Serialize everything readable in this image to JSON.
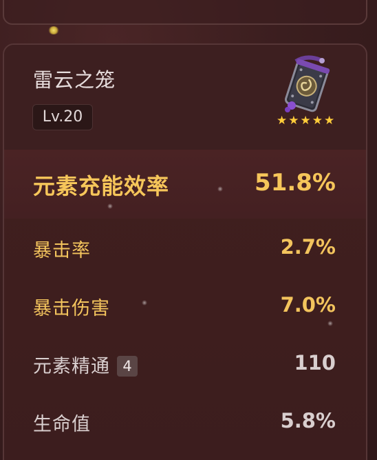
{
  "artifact": {
    "name": "雷云之笼",
    "level": "Lv.20",
    "rarity_stars": 5,
    "icon": "cage-artifact-icon"
  },
  "main_stat": {
    "label": "元素充能效率",
    "value": "51.8%"
  },
  "sub_stats": [
    {
      "label": "暴击率",
      "value": "2.7%",
      "highlight": true
    },
    {
      "label": "暴击伤害",
      "value": "7.0%",
      "highlight": true
    },
    {
      "label": "元素精通",
      "value": "110",
      "highlight": false,
      "rank": "4"
    },
    {
      "label": "生命值",
      "value": "5.8%",
      "highlight": false
    }
  ],
  "colors": {
    "background": "#3a1d1e",
    "gold": "#f3c45d",
    "light_text": "#d9cfcf",
    "star": "#ffcc3a"
  }
}
